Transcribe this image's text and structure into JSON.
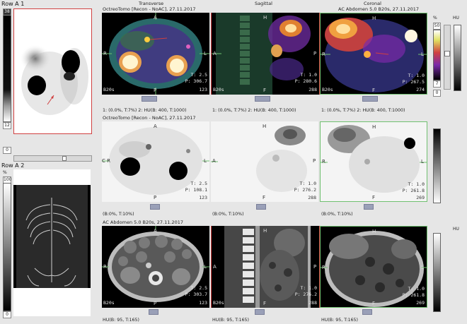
{
  "left_panel": {
    "row1_label": "Row A 1",
    "row2_label": "Row A 2",
    "row1_pct": "%",
    "row1_top": "38",
    "row1_mid": "12",
    "row1_bot": "0",
    "row2_pct": "%",
    "row2_top": "100",
    "row2_bot": "0"
  },
  "columns": {
    "transverse": "Transverse",
    "sagittal": "Sagittal",
    "coronal": "Coronal"
  },
  "rows": {
    "fused": {
      "header_left": "OctreoTomo [Recon - NoAC], 27.11.2017",
      "header_right": "AC Abdomen 5.0 B20s, 27.11.2017",
      "views": [
        {
          "ori_top": "A",
          "ori_left": "R",
          "ori_right": "L",
          "ori_bottom": "P",
          "t": "T: 2.5",
          "p": "P: 306.7",
          "n": "123",
          "corner": "B20s"
        },
        {
          "ori_top": "H",
          "ori_left": "A",
          "ori_right": "P",
          "ori_bottom": "F",
          "t": "T: 1.0",
          "p": "P: 280.6",
          "n": "288",
          "corner": "B20s"
        },
        {
          "ori_top": "H",
          "ori_left": "R",
          "ori_right": "L",
          "ori_bottom": "F",
          "t": "T: 1.0",
          "p": "P: 267.5",
          "n": "274",
          "corner": "B20s"
        }
      ],
      "wl": [
        "1: (0.0%, T:7%)   2: HU(B: 400, T:1000)",
        "1: (0.0%, T:7%)   2: HU(B: 400, T:1000)",
        "1: (0.0%, T:7%)   2: HU(B: 400, T:1000)"
      ],
      "right_scale": {
        "pct": "%",
        "hu": "HU",
        "top": "50",
        "mid": "7",
        "bot": "0"
      }
    },
    "nm": {
      "header_left": "OctreoTomo [Recon - NoAC], 27.11.2017",
      "views": [
        {
          "ori_top": "A",
          "ori_left": "C R",
          "ori_right": "L",
          "ori_bottom": "P",
          "t": "T: 2.5",
          "p": "P: 108.1",
          "n": "123",
          "corner": ""
        },
        {
          "ori_top": "H",
          "ori_left": "A",
          "ori_right": "P",
          "ori_bottom": "F",
          "t": "T: 1.0",
          "p": "P: 276.2",
          "n": "288",
          "corner": ""
        },
        {
          "ori_top": "H",
          "ori_left": "R",
          "ori_right": "L",
          "ori_bottom": "F",
          "t": "T: 1.0",
          "p": "P: 261.8",
          "n": "269",
          "corner": ""
        }
      ],
      "wl": [
        "(B:0%, T:10%)",
        "(B:0%, T:10%)",
        "(B:0%, T:10%)"
      ]
    },
    "ct": {
      "header_left": "AC Abdomen 5.0 B20s, 27.11.2017",
      "views": [
        {
          "ori_top": "A",
          "ori_left": "R",
          "ori_right": "L",
          "ori_bottom": "P",
          "t": "T: 2.5",
          "p": "P: 303.7",
          "n": "123",
          "corner": "B20s"
        },
        {
          "ori_top": "H",
          "ori_left": "A",
          "ori_right": "P",
          "ori_bottom": "F",
          "t": "T: 1.0",
          "p": "P: 276.2",
          "n": "288",
          "corner": "B20s"
        },
        {
          "ori_top": "H",
          "ori_left": "R",
          "ori_right": "L",
          "ori_bottom": "F",
          "t": "T: 1.0",
          "p": "P: 261.8",
          "n": "269",
          "corner": ""
        }
      ],
      "wl": [
        "HU(B: 95, T:165)",
        "HU(B: 95, T:165)",
        "HU(B: 95, T:165)"
      ],
      "right_scale": {
        "hu": "HU"
      }
    }
  },
  "colors": {
    "frame_red": "#d04040",
    "frame_green": "#70c070",
    "bg": "#e6e6e6",
    "tab": "#9aa0b8"
  }
}
